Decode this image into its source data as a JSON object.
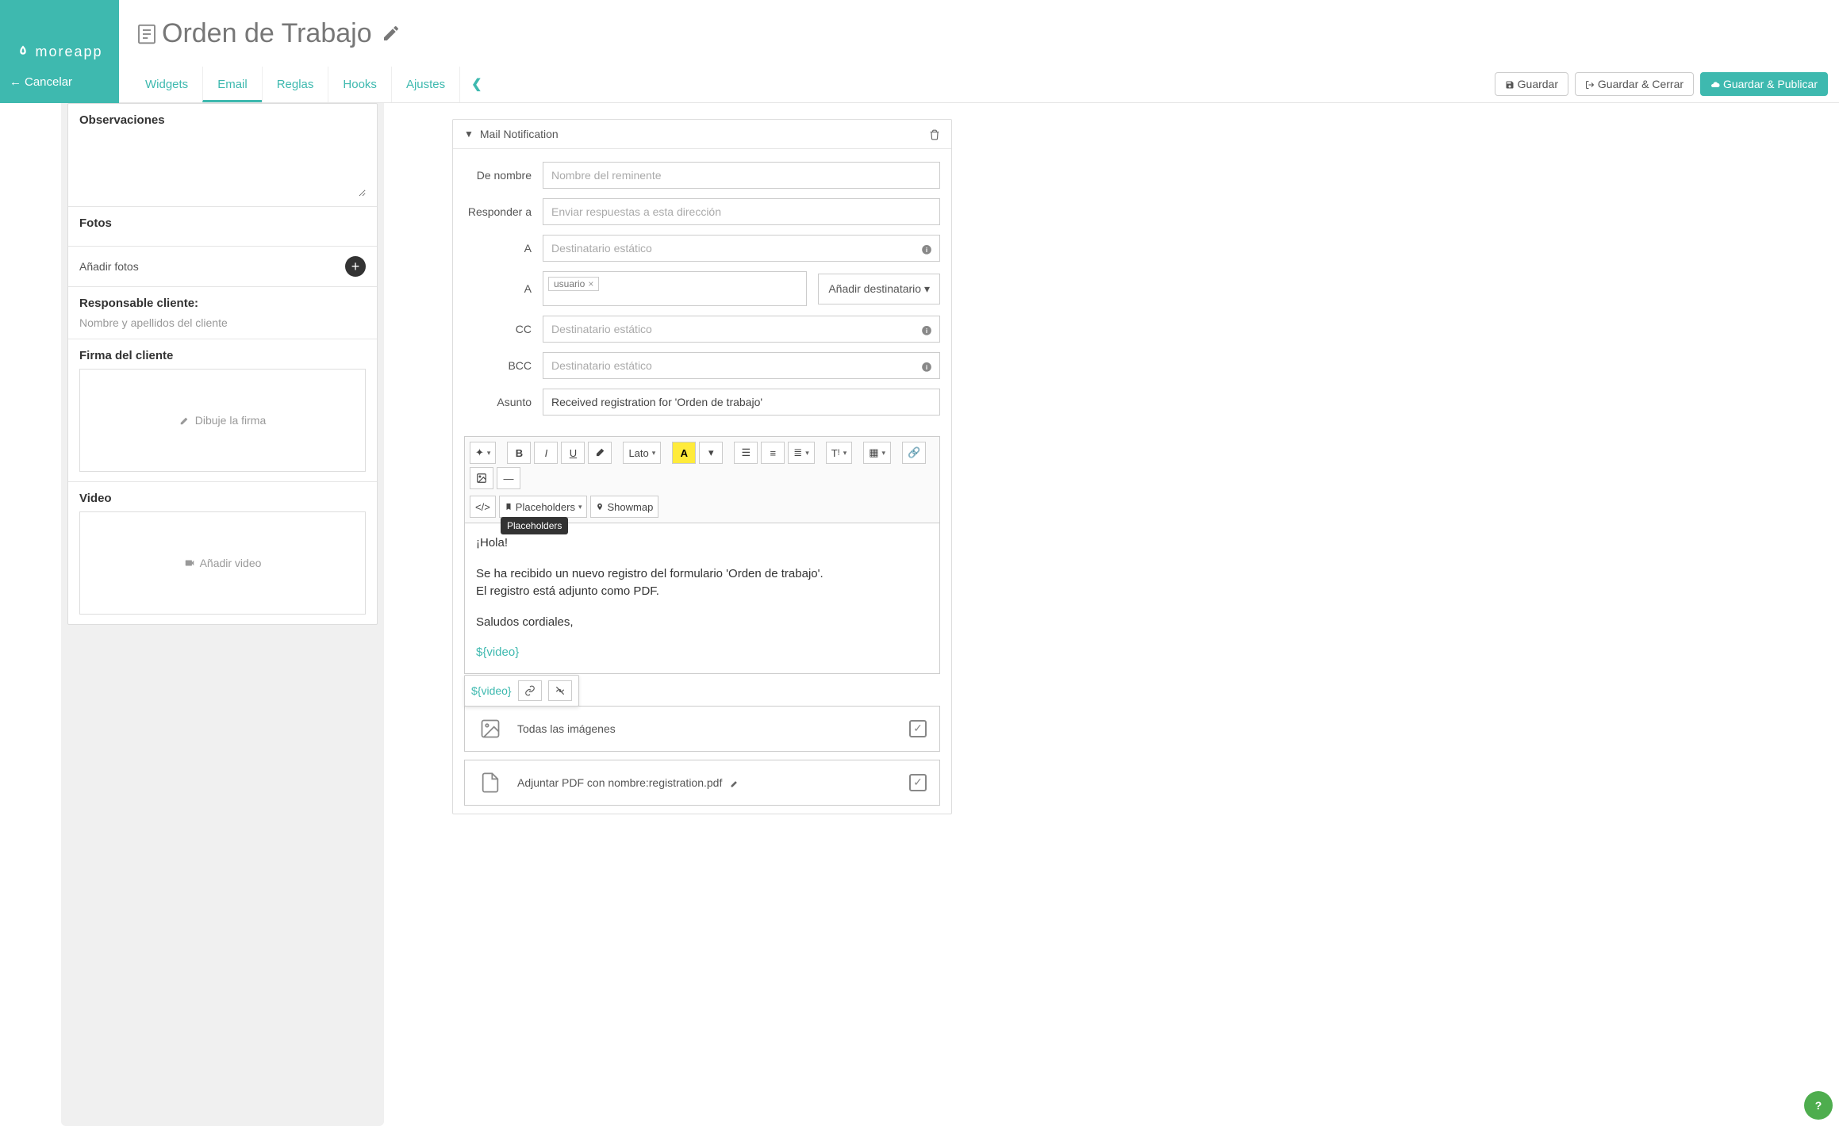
{
  "brand": "moreapp",
  "cancel": "Cancelar",
  "page_title": "Orden de Trabajo",
  "tabs": {
    "widgets": "Widgets",
    "email": "Email",
    "reglas": "Reglas",
    "hooks": "Hooks",
    "ajustes": "Ajustes"
  },
  "actions": {
    "save": "Guardar",
    "save_close": "Guardar & Cerrar",
    "save_publish": "Guardar & Publicar"
  },
  "left": {
    "observaciones": "Observaciones",
    "fotos": "Fotos",
    "anadir_fotos": "Añadir fotos",
    "responsable": "Responsable cliente:",
    "responsable_placeholder": "Nombre y apellidos del cliente",
    "firma": "Firma del cliente",
    "dibuje_firma": "Dibuje la firma",
    "video": "Video",
    "anadir_video": "Añadir video"
  },
  "card": {
    "title": "Mail Notification",
    "labels": {
      "de_nombre": "De nombre",
      "responder": "Responder a",
      "a": "A",
      "cc": "CC",
      "bcc": "BCC",
      "asunto": "Asunto"
    },
    "placeholders": {
      "de_nombre": "Nombre del reminente",
      "responder": "Enviar respuestas a esta dirección",
      "destinatario": "Destinatario estático"
    },
    "chip_usuario": "usuario",
    "add_dest": "Añadir destinatario",
    "asunto_value": "Received registration for 'Orden de trabajo'",
    "toolbar": {
      "font": "Lato",
      "placeholders": "Placeholders",
      "showmap": "Showmap",
      "tooltip_placeholders": "Placeholders"
    },
    "body": {
      "l1": "¡Hola!",
      "l2": "Se ha recibido un nuevo registro del formulario 'Orden de trabajo'.",
      "l3": "El registro está adjunto como PDF.",
      "l4": "Saludos cordiales,",
      "placeholder_video": "${video}"
    },
    "attachments": {
      "all_images": "Todas las imágenes",
      "pdf": "Adjuntar PDF con nombre:registration.pdf"
    }
  }
}
